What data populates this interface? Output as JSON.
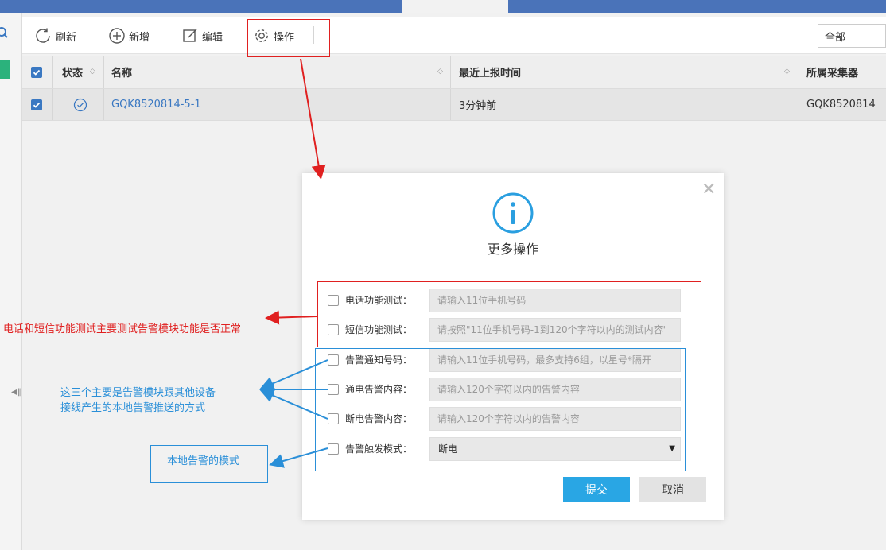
{
  "toolbar": {
    "refresh_label": "刷新",
    "add_label": "新增",
    "edit_label": "编辑",
    "operate_label": "操作",
    "filter_value": "全部"
  },
  "table": {
    "headers": {
      "status": "状态",
      "name": "名称",
      "last_report": "最近上报时间",
      "collector": "所属采集器"
    },
    "rows": [
      {
        "name": "GQK8520814-5-1",
        "last_report": "3分钟前",
        "collector": "GQK8520814"
      }
    ]
  },
  "modal": {
    "title": "更多操作",
    "rows": [
      {
        "label": "电话功能测试：",
        "placeholder": "请输入11位手机号码"
      },
      {
        "label": "短信功能测试：",
        "placeholder": "请按照\"11位手机号码-1到120个字符以内的测试内容\""
      },
      {
        "label": "告警通知号码：",
        "placeholder": "请输入11位手机号码，最多支持6组，以星号*隔开"
      },
      {
        "label": "通电告警内容：",
        "placeholder": "请输入120个字符以内的告警内容"
      },
      {
        "label": "断电告警内容：",
        "placeholder": "请输入120个字符以内的告警内容"
      }
    ],
    "trigger": {
      "label": "告警触发模式：",
      "value": "断电"
    },
    "submit_label": "提交",
    "cancel_label": "取消"
  },
  "annotations": {
    "red_text": "电话和短信功能测试主要测试告警模块功能是否正常",
    "blue_text_line1": "这三个主要是告警模块跟其他设备",
    "blue_text_line2": "接线产生的本地告警推送的方式",
    "mode_text": "本地告警的模式"
  },
  "colors": {
    "brand_blue": "#4a73b9",
    "link_blue": "#3a78c2",
    "submit_blue": "#29a6e4",
    "annotation_red": "#e02020",
    "annotation_blue": "#2a8fd8"
  }
}
